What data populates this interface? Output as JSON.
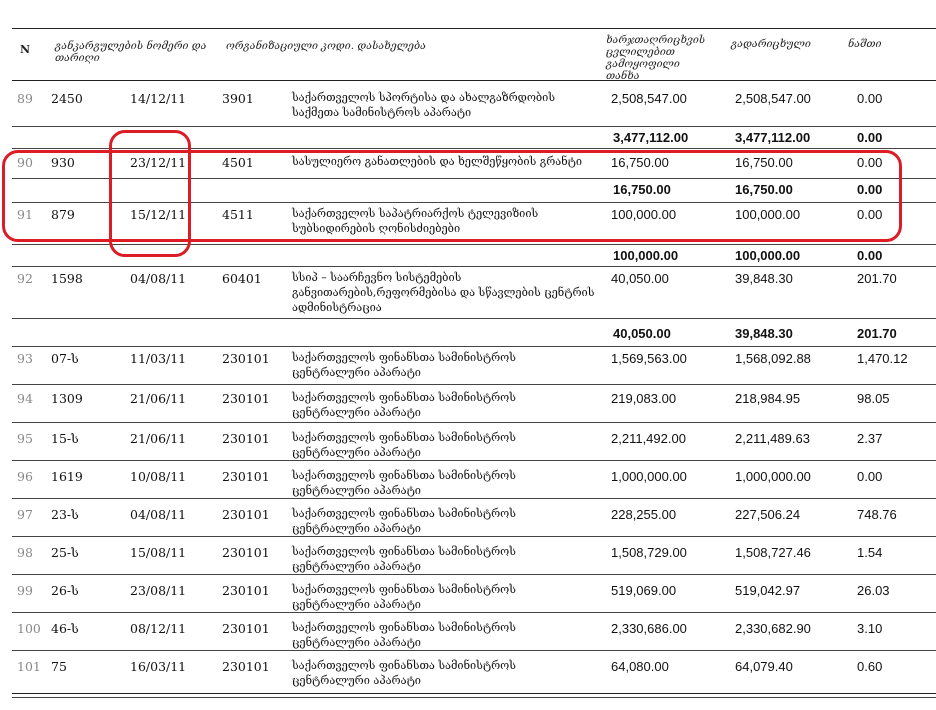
{
  "header": {
    "n": "N",
    "order": "განკარგულების ნომერი და თარიღი",
    "org": "ორგანიზაციული კოდი.  დასახელება",
    "approved": "ხარჯთაღრიცხვის ცვლილებით გამოყოფილი თანხა",
    "transferred": "გადარიცხული",
    "remainder": "ნაშთი"
  },
  "rows": [
    {
      "n": "89",
      "order_no": "2450",
      "date": "14/12/11",
      "code": "3901",
      "name": "საქართველოს სპორტისა და ახალგაზრდობის საქმეთა სამინისტროს აპარატი",
      "approved": "2,508,547.00",
      "transferred": "2,508,547.00",
      "remainder": "0.00"
    },
    {
      "total": true,
      "approved": "3,477,112.00",
      "transferred": "3,477,112.00",
      "remainder": "0.00"
    },
    {
      "n": "90",
      "order_no": "930",
      "date": "23/12/11",
      "code": "4501",
      "name": "სასულიერო განათლების და ხელშეწყობის გრანტი",
      "approved": "16,750.00",
      "transferred": "16,750.00",
      "remainder": "0.00"
    },
    {
      "total": true,
      "approved": "16,750.00",
      "transferred": "16,750.00",
      "remainder": "0.00"
    },
    {
      "n": "91",
      "order_no": "879",
      "date": "15/12/11",
      "code": "4511",
      "name": "საქართველოს საპატრიარქოს ტელევიზიის სუბსიდირების ღონისძიებები",
      "approved": "100,000.00",
      "transferred": "100,000.00",
      "remainder": "0.00"
    },
    {
      "total": true,
      "approved": "100,000.00",
      "transferred": "100,000.00",
      "remainder": "0.00"
    },
    {
      "n": "92",
      "order_no": "1598",
      "date": "04/08/11",
      "code": "60401",
      "name": "სსიპ – საარჩევნო სისტემების განვითარების,რეფორმებისა და სწავლების ცენტრის ადმინისტრაცია",
      "approved": "40,050.00",
      "transferred": "39,848.30",
      "remainder": "201.70"
    },
    {
      "total": true,
      "approved": "40,050.00",
      "transferred": "39,848.30",
      "remainder": "201.70"
    },
    {
      "n": "93",
      "order_no": "07-ს",
      "date": "11/03/11",
      "code": "230101",
      "name": "საქართველოს ფინანსთა სამინისტროს ცენტრალური აპარატი",
      "approved": "1,569,563.00",
      "transferred": "1,568,092.88",
      "remainder": "1,470.12"
    },
    {
      "n": "94",
      "order_no": "1309",
      "date": "21/06/11",
      "code": "230101",
      "name": "საქართველოს ფინანსთა სამინისტროს ცენტრალური აპარატი",
      "approved": "219,083.00",
      "transferred": "218,984.95",
      "remainder": "98.05"
    },
    {
      "n": "95",
      "order_no": "15-ს",
      "date": "21/06/11",
      "code": "230101",
      "name": "საქართველოს ფინანსთა სამინისტროს ცენტრალური აპარატი",
      "approved": "2,211,492.00",
      "transferred": "2,211,489.63",
      "remainder": "2.37"
    },
    {
      "n": "96",
      "order_no": "1619",
      "date": "10/08/11",
      "code": "230101",
      "name": "საქართველოს ფინანსთა სამინისტროს ცენტრალური აპარატი",
      "approved": "1,000,000.00",
      "transferred": "1,000,000.00",
      "remainder": "0.00"
    },
    {
      "n": "97",
      "order_no": "23-ს",
      "date": "04/08/11",
      "code": "230101",
      "name": "საქართველოს ფინანსთა სამინისტროს ცენტრალური აპარატი",
      "approved": "228,255.00",
      "transferred": "227,506.24",
      "remainder": "748.76"
    },
    {
      "n": "98",
      "order_no": "25-ს",
      "date": "15/08/11",
      "code": "230101",
      "name": "საქართველოს ფინანსთა სამინისტროს ცენტრალური აპარატი",
      "approved": "1,508,729.00",
      "transferred": "1,508,727.46",
      "remainder": "1.54"
    },
    {
      "n": "99",
      "order_no": "26-ს",
      "date": "23/08/11",
      "code": "230101",
      "name": "საქართველოს ფინანსთა სამინისტროს ცენტრალური აპარატი",
      "approved": "519,069.00",
      "transferred": "519,042.97",
      "remainder": "26.03"
    },
    {
      "n": "100",
      "order_no": "46-ს",
      "date": "08/12/11",
      "code": "230101",
      "name": "საქართველოს ფინანსთა სამინისტროს ცენტრალური აპარატი",
      "approved": "2,330,686.00",
      "transferred": "2,330,682.90",
      "remainder": "3.10"
    },
    {
      "n": "101",
      "order_no": "75",
      "date": "16/03/11",
      "code": "230101",
      "name": "საქართველოს ფინანსთა სამინისტროს ცენტრალური აპარატი",
      "approved": "64,080.00",
      "transferred": "64,079.40",
      "remainder": "0.60"
    }
  ],
  "annotations": {
    "color": "#dc1d25"
  }
}
